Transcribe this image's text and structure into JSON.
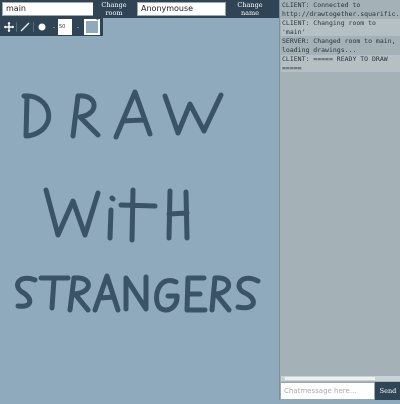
{
  "room_input": {
    "value": "main"
  },
  "change_room_label": "Change room",
  "name_input": {
    "value": "Anonymouse"
  },
  "change_name_label": "Change name",
  "toolbar": {
    "size_value": "50",
    "swatch_marker": "*",
    "tools": [
      {
        "name": "move-icon",
        "label": "✥"
      },
      {
        "name": "pen-icon",
        "label": "╱"
      },
      {
        "name": "brush-icon",
        "label": "●"
      }
    ]
  },
  "colors": {
    "bar": "#2f4556",
    "canvas": "#8fa9bd",
    "ink": "#3a5366",
    "chat_bg": "#a4b1b6"
  },
  "canvas_drawing": {
    "lines": [
      "DRAW",
      "WITH",
      "STRANGERS"
    ]
  },
  "chat": {
    "messages": [
      "CLIENT: Connected to http://drawtogether.squarific.",
      "CLIENT: Changing room to 'main'",
      "SERVER: Changed room to main, loading drawings...",
      "CLIENT: ===== READY TO DRAW ====="
    ],
    "placeholder": "Chatmessage here...",
    "send_label": "Send"
  }
}
